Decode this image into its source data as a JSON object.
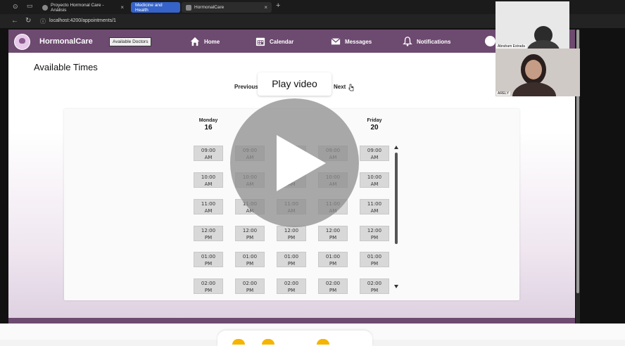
{
  "browser": {
    "tabs": [
      {
        "label": "Proyecto Hormonal Care - Análisis"
      },
      {
        "label": "Medicine and Health"
      },
      {
        "label": "HormonalCare"
      }
    ],
    "url": "localhost:4200/appointments/1"
  },
  "app": {
    "brand": "HormonalCare",
    "available_doctors_label": "Available Doctors",
    "nav": {
      "home": "Home",
      "calendar": "Calendar",
      "messages": "Messages",
      "notifications": "Notifications"
    },
    "page_title": "Available Times",
    "pagination": {
      "previous": "Previous",
      "next": "Next"
    },
    "days": [
      {
        "name": "Monday",
        "date": "16"
      },
      {
        "name": "",
        "date": ""
      },
      {
        "name": "",
        "date": ""
      },
      {
        "name": "",
        "date": ""
      },
      {
        "name": "Friday",
        "date": "20"
      }
    ],
    "slots": [
      {
        "time": "09:00",
        "period": "AM"
      },
      {
        "time": "10:00",
        "period": "AM"
      },
      {
        "time": "11:00",
        "period": "AM"
      },
      {
        "time": "12:00",
        "period": "PM"
      },
      {
        "time": "01:00",
        "period": "PM"
      },
      {
        "time": "02:00",
        "period": "PM"
      }
    ]
  },
  "video": {
    "play_label": "Play video"
  },
  "participants": [
    {
      "name": "Abraham Estrada"
    },
    {
      "name": "ARELY"
    }
  ],
  "colors": {
    "navbar": "#6d4a70",
    "slot": "#d8d8d8",
    "accent": "#1a73e8"
  }
}
